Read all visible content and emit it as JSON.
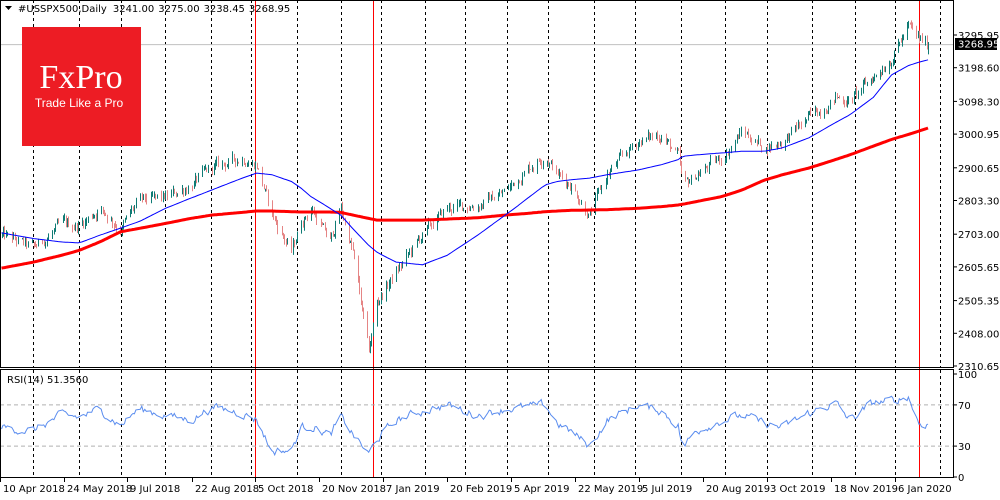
{
  "header": {
    "symbol_timeframe": "#USSPX500,Daily",
    "open": "3241.00",
    "high": "3275.00",
    "low": "3238.45",
    "close": "3268.95",
    "menu_icon": "triangle-down-icon"
  },
  "logo": {
    "brand": "FxPro",
    "tagline": "Trade Like a Pro",
    "color": "#ed1c24"
  },
  "current_price_label": "3268.95",
  "rsi_label": "RSI(14) 51.3560",
  "colors": {
    "up_bar": "#0f7b74",
    "down_bar": "#e58585",
    "ma_fast": "#0000ff",
    "ma_slow": "#ff0000",
    "rsi": "#5b8def",
    "separator": "#ff0000"
  },
  "chart_data": [
    {
      "type": "ohlc-bar",
      "series_names": [
        "close",
        "ma_fast",
        "ma_slow"
      ],
      "y_ticks": [
        "3295.95",
        "3198.60",
        "3098.30",
        "3000.95",
        "2900.65",
        "2803.30",
        "2703.00",
        "2605.65",
        "2505.35",
        "2408.00",
        "2310.65"
      ],
      "ylim": [
        2310.65,
        3295.95
      ],
      "x_ticks": [
        "10 Apr 2018",
        "24 May 2018",
        "9 Jul 2018",
        "22 Aug 2018",
        "5 Oct 2018",
        "20 Nov 2018",
        "7 Jan 2019",
        "20 Feb 2019",
        "5 Apr 2019",
        "22 May 2019",
        "5 Jul 2019",
        "20 Aug 2019",
        "3 Oct 2019",
        "18 Nov 2019",
        "6 Jan 2020"
      ],
      "grid": "vertical dashed",
      "last_bar": {
        "open": 3241.0,
        "high": 3275.0,
        "low": 3238.45,
        "close": 3268.95
      },
      "points": [
        [
          "2018-04-09",
          2700,
          2707,
          2602
        ],
        [
          "2018-05-01",
          2660,
          2690,
          2620
        ],
        [
          "2018-05-20",
          2730,
          2680,
          2640
        ],
        [
          "2018-06-02",
          2730,
          2677,
          2655
        ],
        [
          "2018-06-17",
          2780,
          2700,
          2680
        ],
        [
          "2018-07-02",
          2720,
          2721,
          2710
        ],
        [
          "2018-07-15",
          2800,
          2740,
          2720
        ],
        [
          "2018-08-02",
          2810,
          2780,
          2735
        ],
        [
          "2018-08-19",
          2850,
          2810,
          2750
        ],
        [
          "2018-09-03",
          2900,
          2835,
          2760
        ],
        [
          "2018-09-24",
          2930,
          2870,
          2768
        ],
        [
          "2018-10-04",
          2910,
          2885,
          2772
        ],
        [
          "2018-10-15",
          2760,
          2880,
          2772
        ],
        [
          "2018-10-29",
          2650,
          2860,
          2770
        ],
        [
          "2018-11-05",
          2740,
          2840,
          2769
        ],
        [
          "2018-11-12",
          2780,
          2815,
          2769
        ],
        [
          "2018-11-26",
          2680,
          2780,
          2769
        ],
        [
          "2018-12-04",
          2780,
          2760,
          2768
        ],
        [
          "2018-12-13",
          2650,
          2720,
          2760
        ],
        [
          "2018-12-25",
          2350,
          2670,
          2750
        ],
        [
          "2018-12-31",
          2500,
          2650,
          2745
        ],
        [
          "2019-01-14",
          2590,
          2620,
          2745
        ],
        [
          "2019-02-01",
          2700,
          2612,
          2745
        ],
        [
          "2019-02-18",
          2780,
          2640,
          2748
        ],
        [
          "2019-03-11",
          2790,
          2700,
          2752
        ],
        [
          "2019-03-30",
          2830,
          2760,
          2760
        ],
        [
          "2019-04-15",
          2900,
          2810,
          2765
        ],
        [
          "2019-04-28",
          2940,
          2850,
          2770
        ],
        [
          "2019-05-07",
          2880,
          2860,
          2772
        ],
        [
          "2019-05-17",
          2850,
          2865,
          2774
        ],
        [
          "2019-05-30",
          2760,
          2870,
          2775
        ],
        [
          "2019-06-11",
          2880,
          2880,
          2776
        ],
        [
          "2019-07-02",
          2980,
          2894,
          2780
        ],
        [
          "2019-07-19",
          3000,
          2910,
          2785
        ],
        [
          "2019-07-31",
          2930,
          2925,
          2790
        ],
        [
          "2019-08-03",
          2840,
          2935,
          2792
        ],
        [
          "2019-08-13",
          2880,
          2939,
          2800
        ],
        [
          "2019-08-31",
          2930,
          2945,
          2815
        ],
        [
          "2019-09-14",
          3010,
          2950,
          2835
        ],
        [
          "2019-09-29",
          2960,
          2950,
          2864
        ],
        [
          "2019-10-12",
          2980,
          2960,
          2880
        ],
        [
          "2019-10-31",
          3050,
          2990,
          2900
        ],
        [
          "2019-11-19",
          3110,
          3035,
          2925
        ],
        [
          "2019-11-30",
          3100,
          3058,
          2939
        ],
        [
          "2019-12-18",
          3170,
          3110,
          2965
        ],
        [
          "2020-01-01",
          3230,
          3177,
          2985
        ],
        [
          "2020-01-14",
          3320,
          3205,
          3000
        ],
        [
          "2020-01-22",
          3280,
          3215,
          3010
        ],
        [
          "2020-01-29",
          3268.95,
          3222,
          3019
        ]
      ]
    },
    {
      "type": "line",
      "name": "RSI(14)",
      "ylim": [
        0,
        100
      ],
      "y_ticks": [
        "100",
        "70",
        "30",
        "0"
      ],
      "levels": [
        70,
        30
      ],
      "points": [
        [
          "2018-04-09",
          48
        ],
        [
          "2018-05-01",
          45
        ],
        [
          "2018-05-20",
          60
        ],
        [
          "2018-06-02",
          58
        ],
        [
          "2018-06-17",
          66
        ],
        [
          "2018-07-02",
          50
        ],
        [
          "2018-07-15",
          66
        ],
        [
          "2018-08-02",
          60
        ],
        [
          "2018-08-19",
          55
        ],
        [
          "2018-09-03",
          68
        ],
        [
          "2018-09-24",
          62
        ],
        [
          "2018-10-04",
          56
        ],
        [
          "2018-10-15",
          25
        ],
        [
          "2018-10-29",
          26
        ],
        [
          "2018-11-05",
          48
        ],
        [
          "2018-11-12",
          50
        ],
        [
          "2018-11-26",
          40
        ],
        [
          "2018-12-04",
          58
        ],
        [
          "2018-12-13",
          42
        ],
        [
          "2018-12-25",
          22
        ],
        [
          "2018-12-31",
          36
        ],
        [
          "2019-01-14",
          55
        ],
        [
          "2019-02-01",
          64
        ],
        [
          "2019-02-18",
          70
        ],
        [
          "2019-03-11",
          60
        ],
        [
          "2019-03-30",
          66
        ],
        [
          "2019-04-15",
          68
        ],
        [
          "2019-04-28",
          70
        ],
        [
          "2019-05-07",
          52
        ],
        [
          "2019-05-17",
          44
        ],
        [
          "2019-05-30",
          30
        ],
        [
          "2019-06-11",
          55
        ],
        [
          "2019-07-02",
          70
        ],
        [
          "2019-07-19",
          64
        ],
        [
          "2019-07-31",
          50
        ],
        [
          "2019-08-03",
          28
        ],
        [
          "2019-08-13",
          45
        ],
        [
          "2019-08-31",
          55
        ],
        [
          "2019-09-14",
          60
        ],
        [
          "2019-09-29",
          52
        ],
        [
          "2019-10-12",
          48
        ],
        [
          "2019-10-31",
          62
        ],
        [
          "2019-11-19",
          72
        ],
        [
          "2019-11-30",
          55
        ],
        [
          "2019-12-18",
          72
        ],
        [
          "2020-01-01",
          74
        ],
        [
          "2020-01-14",
          78
        ],
        [
          "2020-01-22",
          52
        ],
        [
          "2020-01-29",
          51.356
        ]
      ]
    }
  ]
}
